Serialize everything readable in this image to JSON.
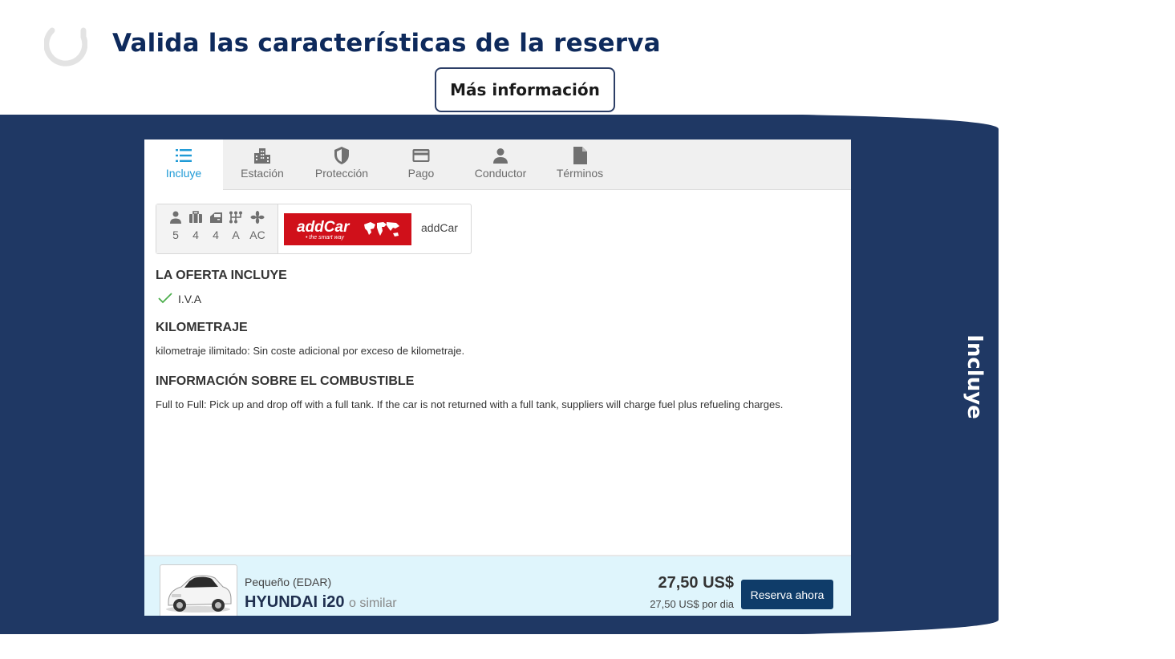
{
  "slide": {
    "title": "Valida las características de la reserva",
    "more_info_label": "Más información",
    "side_label": "Incluye"
  },
  "tabs": [
    {
      "label": "Incluye",
      "icon": "list-icon",
      "active": true
    },
    {
      "label": "Estación",
      "icon": "building-icon",
      "active": false
    },
    {
      "label": "Protección",
      "icon": "shield-icon",
      "active": false
    },
    {
      "label": "Pago",
      "icon": "credit-card-icon",
      "active": false
    },
    {
      "label": "Conductor",
      "icon": "person-icon",
      "active": false
    },
    {
      "label": "Términos",
      "icon": "document-icon",
      "active": false
    }
  ],
  "specs": [
    {
      "icon": "passenger-icon",
      "value": "5"
    },
    {
      "icon": "luggage-icon",
      "value": "4"
    },
    {
      "icon": "door-icon",
      "value": "4"
    },
    {
      "icon": "transmission-icon",
      "value": "A"
    },
    {
      "icon": "air-conditioning-icon",
      "value": "AC"
    }
  ],
  "supplier": {
    "logo_text": "addCar",
    "logo_tagline": "• the smart way",
    "name": "addCar"
  },
  "offer": {
    "title": "LA OFERTA INCLUYE",
    "items": [
      "I.V.A"
    ]
  },
  "mileage": {
    "title": "KILOMETRAJE",
    "text": "kilometraje ilimitado: Sin coste adicional por exceso de kilometraje."
  },
  "fuel": {
    "title": "INFORMACIÓN SOBRE EL COMBUSTIBLE",
    "text": "Full to Full: Pick up and drop off with a full tank. If the car is not returned with a full tank, suppliers will charge fuel plus refueling charges."
  },
  "footer": {
    "category": "Pequeño (EDAR)",
    "model": "HYUNDAI i20",
    "similar": "o similar",
    "price": "27,50 US$",
    "per_day": "27,50 US$ por dia",
    "reserve_label": "Reserva ahora"
  },
  "colors": {
    "brand_navy": "#1f3864",
    "title_navy": "#0e2a5c",
    "tab_active": "#1e9ad6",
    "footer_bg": "#dff5fc",
    "reserve_button": "#0f3c69",
    "addcar_red": "#d0101a"
  }
}
